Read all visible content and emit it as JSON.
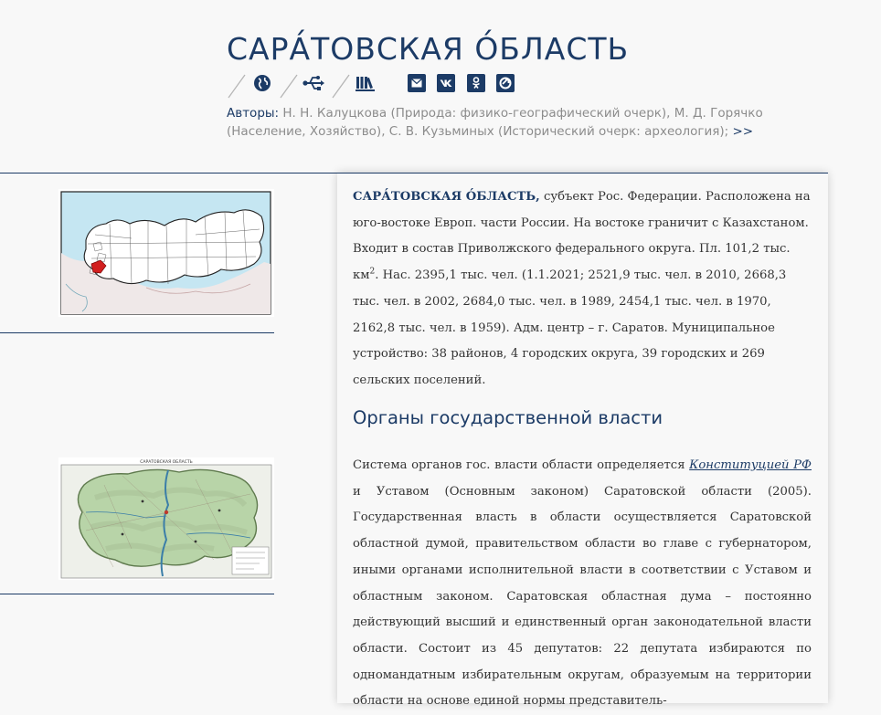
{
  "header": {
    "title": "САРА́ТОВСКАЯ О́БЛАСТЬ",
    "toolbar": [
      {
        "icon": "globe-icon"
      },
      {
        "icon": "usb-icon"
      },
      {
        "icon": "books-icon"
      }
    ],
    "share": [
      {
        "icon": "mail-icon"
      },
      {
        "icon": "vk-icon"
      },
      {
        "icon": "odnoklassniki-icon"
      },
      {
        "icon": "link-icon"
      }
    ],
    "authors_label": "Авторы:",
    "authors_text": "Н. Н. Калуцкова (Природа: физико-географический очерк), М. Д. Горячко (Население, Хозяйство), С. В. Кузьминых (Исторический очерк: археология);",
    "authors_more": ">>"
  },
  "colors": {
    "accent": "#1c3b66",
    "region_highlight": "#d21f1f",
    "text_muted": "#8c8c8c"
  },
  "article": {
    "lead_term": "САРА́ТОВСКАЯ О́БЛАСТЬ,",
    "intro_before_sup": "субъект Рос. Федерации. Расположена на юго-востоке Европ. части России. На востоке граничит с Казахстаном. Входит в состав Приволжского федерального округа. Пл. 101,2 тыс. км",
    "intro_sup": "2",
    "intro_after_sup": ". Нас. 2395,1 тыс. чел. (1.1.2021; 2521,9 тыс. чел. в 2010, 2668,3 тыс. чел. в 2002, 2684,0 тыс. чел. в 1989, 2454,1 тыс. чел. в 1970, 2162,8 тыс. чел. в 1959). Адм. центр – г. Саратов. Муниципальное устройство: 38 районов, 4 городских округа, 39 городских и 269 сельских поселений.",
    "section_heading": "Органы государственной власти",
    "section_before_link": "Система органов гос. власти области определяется",
    "section_link": "Конституцией РФ",
    "section_after_link": "и Уставом (Основным законом) Саратовской области (2005). Государственная власть в области осуществляется Саратовской областной думой, правительством области во главе с губернатором, иными органами исполнительной власти в соответствии с Уставом и областным законом. Саратовская областная дума – постоянно действующий высший и единственный орган законодательной власти области. Состоит из 45 депутатов: 22 депутата избираются по одномандатным избирательным округам, образуемым на территории области на основе единой нормы представитель-"
  },
  "figures": {
    "map2_caption": "САРАТОВСКАЯ ОБЛАСТЬ"
  }
}
